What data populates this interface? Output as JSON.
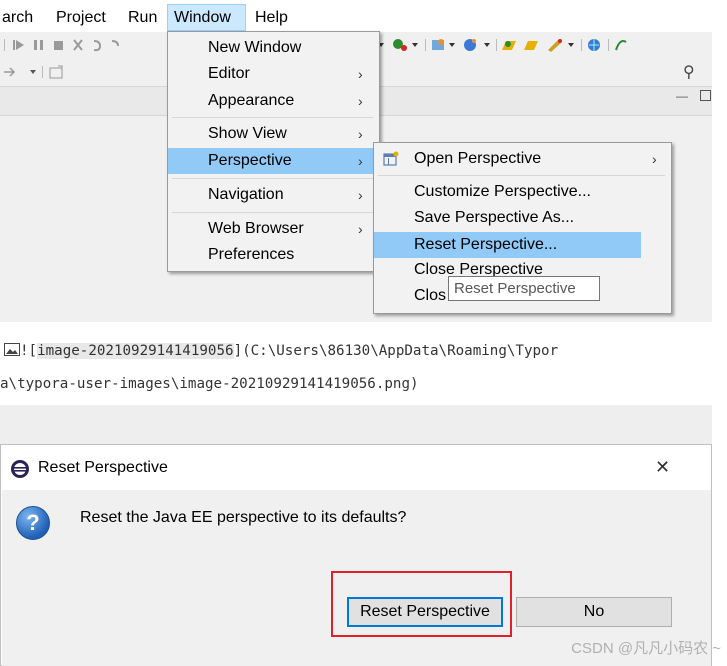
{
  "menubar": {
    "items": [
      "arch",
      "Project",
      "Run",
      "Window",
      "Help"
    ]
  },
  "window_menu": {
    "items": [
      {
        "label": "New Window",
        "submenu": false
      },
      {
        "label": "Editor",
        "submenu": true
      },
      {
        "label": "Appearance",
        "submenu": true
      },
      {
        "label": "Show View",
        "submenu": true
      },
      {
        "label": "Perspective",
        "submenu": true,
        "selected": true
      },
      {
        "label": "Navigation",
        "submenu": true
      },
      {
        "label": "Web Browser",
        "submenu": true
      },
      {
        "label": "Preferences",
        "submenu": false
      }
    ]
  },
  "perspective_menu": {
    "items": [
      {
        "label": "Open Perspective",
        "submenu": true
      },
      {
        "label": "Customize Perspective...",
        "submenu": false
      },
      {
        "label": "Save Perspective As...",
        "submenu": false
      },
      {
        "label": "Reset Perspective...",
        "submenu": false,
        "selected": true
      },
      {
        "label": "Close Perspective",
        "submenu": false
      },
      {
        "label": "Clos",
        "submenu": false
      }
    ]
  },
  "tooltip": "Reset Perspective",
  "markdown": {
    "line1_prefix": "![",
    "alt_text": "image-20210929141419056",
    "line1_suffix": "](C:\\Users\\86130\\AppData\\Roaming\\Typor",
    "line2": "a\\typora-user-images\\image-20210929141419056.png)"
  },
  "dialog": {
    "title": "Reset Perspective",
    "close_glyph": "✕",
    "message": "Reset the Java EE perspective to its defaults?",
    "question_glyph": "?",
    "buttons": {
      "reset": "Reset Perspective",
      "no": "No"
    }
  },
  "watermark": "CSDN @凡凡小码农 ~",
  "icons": {
    "arrow": "›",
    "search": "🔍"
  },
  "colors": {
    "selection": "#91c9f7",
    "menu_hover": "#cce8ff",
    "focus_border": "#0078d7",
    "highlight_box": "#e0202a"
  }
}
